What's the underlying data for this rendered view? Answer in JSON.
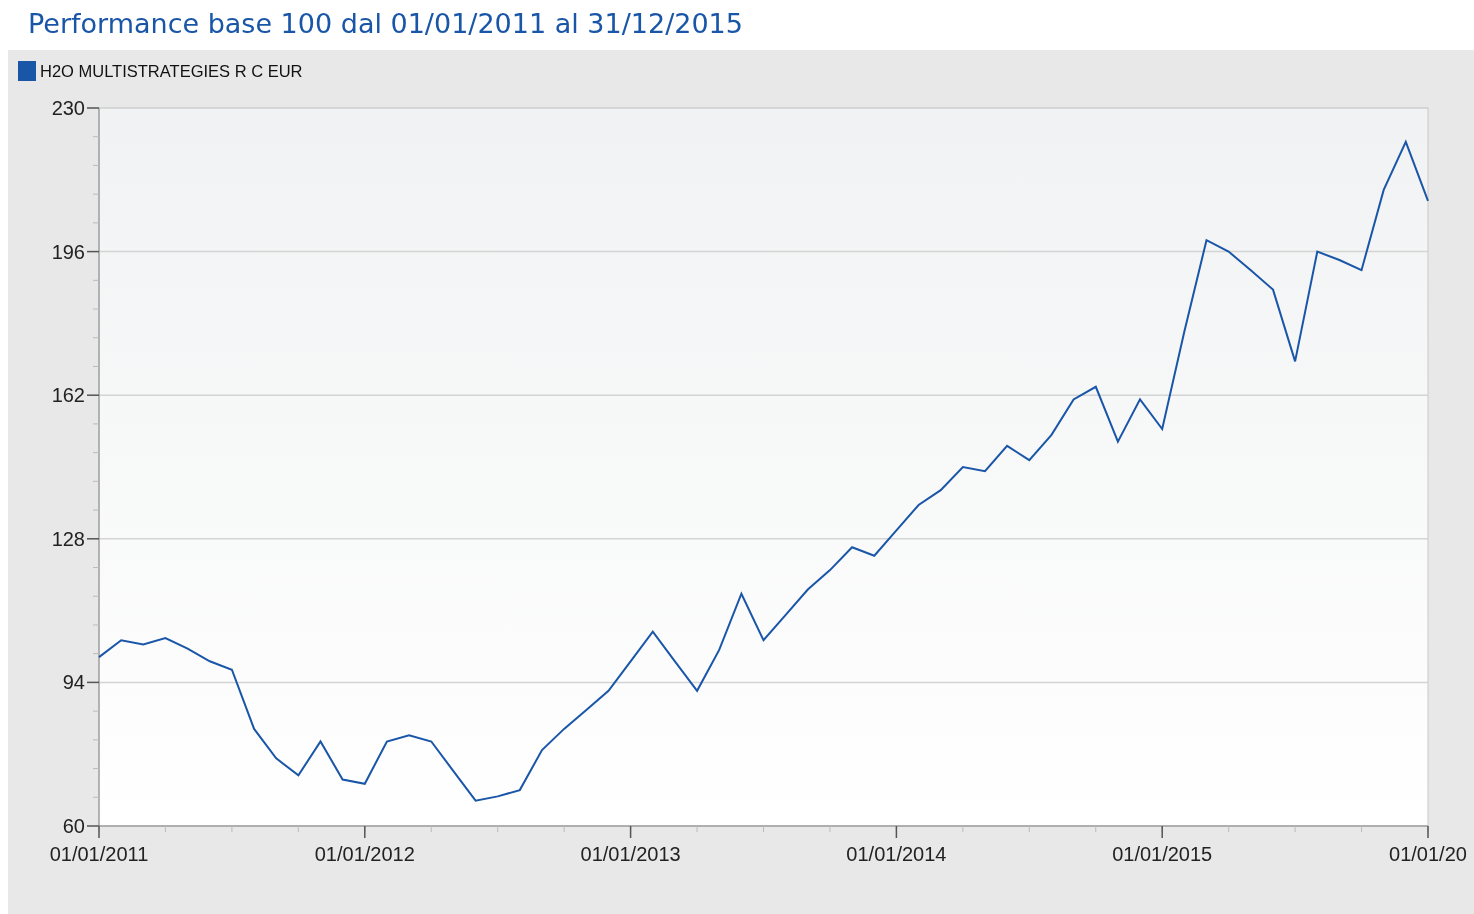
{
  "title": "Performance base 100 dal 01/01/2011 al 31/12/2015",
  "chart": {
    "chart_data": {
      "type": "line",
      "grid": true,
      "ylim": [
        60,
        230
      ],
      "categories": [
        "01/01/2011",
        null,
        null,
        null,
        null,
        null,
        null,
        null,
        null,
        null,
        null,
        null,
        "01/01/2012",
        null,
        null,
        null,
        null,
        null,
        null,
        null,
        null,
        null,
        null,
        null,
        "01/01/2013",
        null,
        null,
        null,
        null,
        null,
        null,
        null,
        null,
        null,
        null,
        null,
        "01/01/2014",
        null,
        null,
        null,
        null,
        null,
        null,
        null,
        null,
        null,
        null,
        null,
        "01/01/2015",
        null,
        null,
        null,
        null,
        null,
        null,
        null,
        null,
        null,
        null,
        null,
        "01/01/20"
      ],
      "series": [
        {
          "name": "H2O MULTISTRATEGIES R C EUR",
          "color": "#1a56a8",
          "values": [
            100,
            104,
            103,
            104.5,
            102,
            99,
            97,
            83,
            76,
            72,
            80,
            71,
            70,
            80,
            81.5,
            80,
            73,
            66,
            67,
            68.5,
            78,
            83,
            87.5,
            92,
            99,
            106,
            99,
            92,
            101.7,
            115,
            104,
            110,
            116,
            120.6,
            126,
            124,
            130,
            136,
            139.5,
            145,
            144,
            150,
            146.6,
            152.6,
            161,
            164,
            151,
            161,
            154,
            177,
            198.7,
            196,
            191.6,
            187,
            170,
            196,
            194,
            191.6,
            210.6,
            222,
            208
          ]
        }
      ],
      "yticks": [
        60,
        94,
        128,
        162,
        196,
        230
      ]
    }
  }
}
